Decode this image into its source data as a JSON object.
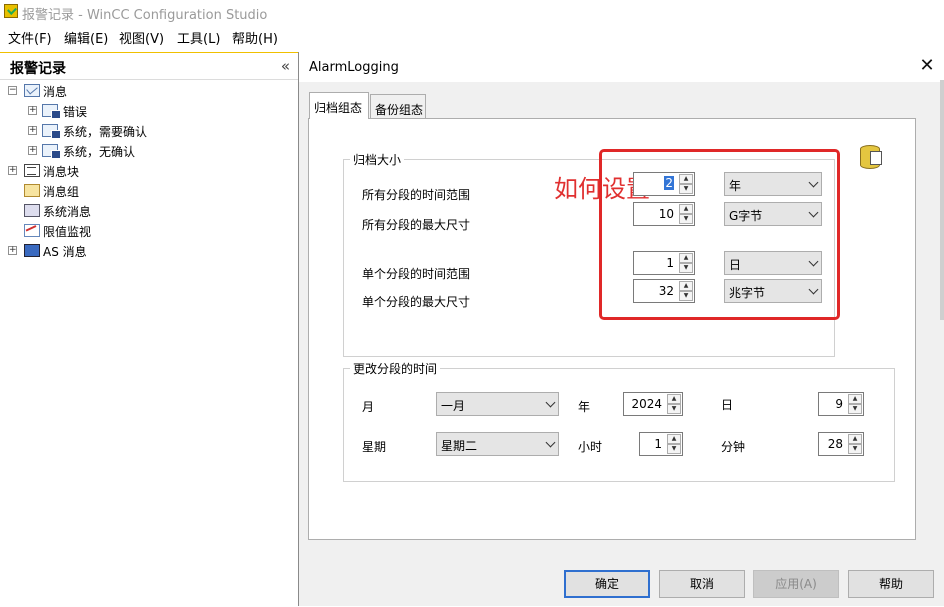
{
  "app": {
    "title": "报警记录 - WinCC Configuration Studio"
  },
  "menu": [
    "文件(F)",
    "编辑(E)",
    "视图(V)",
    "工具(L)",
    "帮助(H)"
  ],
  "left_pane": {
    "title": "报警记录",
    "collapse_glyph": "«",
    "tree": [
      {
        "label": "消息",
        "expander": "−",
        "icon": "message-icon"
      },
      {
        "label": "错误",
        "expander": "+",
        "icon": "message-db-icon"
      },
      {
        "label": "系统，需要确认",
        "expander": "+",
        "icon": "message-db-icon"
      },
      {
        "label": "系统，无确认",
        "expander": "+",
        "icon": "message-db-icon"
      },
      {
        "label": "消息块",
        "expander": "+",
        "icon": "message-block-icon"
      },
      {
        "label": "消息组",
        "expander": "",
        "icon": "message-group-icon"
      },
      {
        "label": "系统消息",
        "expander": "",
        "icon": "system-message-icon"
      },
      {
        "label": "限值监视",
        "expander": "",
        "icon": "limit-monitor-icon"
      },
      {
        "label": "AS 消息",
        "expander": "+",
        "icon": "as-message-icon"
      }
    ]
  },
  "dialog": {
    "title": "AlarmLogging",
    "close_glyph": "✕",
    "tabs": [
      "归档组态",
      "备份组态"
    ],
    "annotation": "如何设置",
    "archive_size": {
      "legend": "归档大小",
      "rows": [
        {
          "label": "所有分段的时间范围",
          "value": "2",
          "unit": "年",
          "unit_enabled": false
        },
        {
          "label": "所有分段的最大尺寸",
          "value": "10",
          "unit": "G字节",
          "unit_enabled": false
        },
        {
          "label": "单个分段的时间范围",
          "value": "1",
          "unit": "日",
          "unit_enabled": false
        },
        {
          "label": "单个分段的最大尺寸",
          "value": "32",
          "unit": "兆字节",
          "unit_enabled": false
        }
      ]
    },
    "change_time": {
      "legend": "更改分段的时间",
      "month_label": "月",
      "month_value": "一月",
      "year_label": "年",
      "year_value": "2024",
      "day_label": "日",
      "day_value": "9",
      "weekday_label": "星期",
      "weekday_value": "星期二",
      "hour_label": "小时",
      "hour_value": "1",
      "minute_label": "分钟",
      "minute_value": "28"
    },
    "buttons": {
      "ok": "确定",
      "cancel": "取消",
      "apply": "应用(A)",
      "help": "帮助"
    }
  },
  "colors": {
    "annotation_red": "#e02828",
    "selection_blue": "#3375d6",
    "default_button_border": "#2f6fcf"
  }
}
